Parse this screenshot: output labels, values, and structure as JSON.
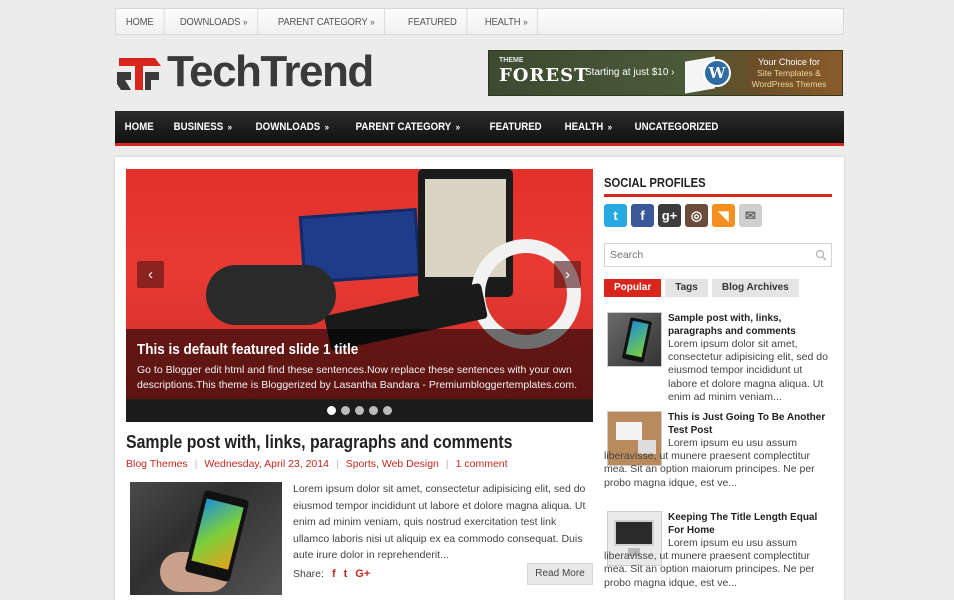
{
  "top_nav": [
    {
      "label": "HOME",
      "has_sub": false
    },
    {
      "label": "DOWNLOADS",
      "has_sub": true
    },
    {
      "label": "PARENT CATEGORY",
      "has_sub": true
    },
    {
      "label": "FEATURED",
      "has_sub": false
    },
    {
      "label": "HEALTH",
      "has_sub": true
    }
  ],
  "logo": {
    "title": "TechTrend"
  },
  "banner": {
    "small": "THEME",
    "brand": "FOREST",
    "price": "Starting at just $10",
    "chevron": "›",
    "wp_letter": "W",
    "tag1": "Your Choice for",
    "tag2": "Site Templates &",
    "tag3": "WordPress Themes"
  },
  "main_nav": [
    {
      "label": "HOME",
      "has_sub": false
    },
    {
      "label": "BUSINESS",
      "has_sub": true
    },
    {
      "label": "DOWNLOADS",
      "has_sub": true
    },
    {
      "label": "PARENT CATEGORY",
      "has_sub": true
    },
    {
      "label": "FEATURED",
      "has_sub": false
    },
    {
      "label": "HEALTH",
      "has_sub": true
    },
    {
      "label": "UNCATEGORIZED",
      "has_sub": false
    }
  ],
  "sub_arrow": "»",
  "slider": {
    "title": "This is default featured slide 1 title",
    "description": "Go to Blogger edit html and find these sentences.Now replace these sentences with your own descriptions.This theme is Bloggerized by Lasantha Bandara - Premiumbloggertemplates.com.",
    "prev": "‹",
    "next": "›",
    "dots": 5,
    "active_dot": 0
  },
  "post": {
    "title": "Sample post with, links, paragraphs and comments",
    "category": "Blog Themes",
    "date": "Wednesday, April 23, 2014",
    "labels": "Sports, Web Design",
    "comments": "1 comment",
    "excerpt": "Lorem ipsum dolor sit amet, consectetur adipisicing elit, sed do eiusmod tempor incididunt ut labore et dolore magna aliqua. Ut enim ad minim veniam, quis nostrud exercitation test link ullamco laboris nisi ut aliquip ex ea commodo consequat. Duis aute irure dolor in reprehenderit...",
    "share_label": "Share:",
    "share_icons": [
      "f",
      "t",
      "G+"
    ],
    "read_more": "Read More"
  },
  "sidebar": {
    "social_title": "SOCIAL PROFILES",
    "social_icons": [
      {
        "name": "twitter-icon",
        "glyph": "t",
        "color": "#29a9e1"
      },
      {
        "name": "facebook-icon",
        "glyph": "f",
        "color": "#3b5998"
      },
      {
        "name": "google-plus-icon",
        "glyph": "g+",
        "color": "#3c3c3c"
      },
      {
        "name": "instagram-icon",
        "glyph": "◎",
        "color": "#6b4b3a"
      },
      {
        "name": "rss-icon",
        "glyph": "◥",
        "color": "#f5901e"
      },
      {
        "name": "email-icon",
        "glyph": "✉",
        "color": "#cfcfcf"
      }
    ],
    "search_placeholder": "Search",
    "tabs": [
      "Popular",
      "Tags",
      "Blog Archives"
    ],
    "popular_posts": [
      {
        "title": "Sample post with, links, paragraphs and comments",
        "text": "Lorem ipsum dolor sit amet, consectetur adipisicing elit, sed do eiusmod tempor incididunt ut labore et dolore magna aliqua. Ut enim ad minim veniam..."
      },
      {
        "title": "This is Just Going To Be Another Test Post",
        "text": "Lorem ipsum eu usu assum liberavisse, ut munere praesent complectitur mea. Sit an option maiorum principes. Ne per probo magna idque, est ve..."
      },
      {
        "title": "Keeping The Title Length Equal For Home",
        "text": "Lorem ipsum eu usu assum liberavisse, ut munere praesent complectitur mea. Sit an option maiorum principes. Ne per probo magna idque, est ve..."
      }
    ]
  },
  "colors": {
    "accent": "#d9261c",
    "nav_bg": "#1a1a1a"
  }
}
